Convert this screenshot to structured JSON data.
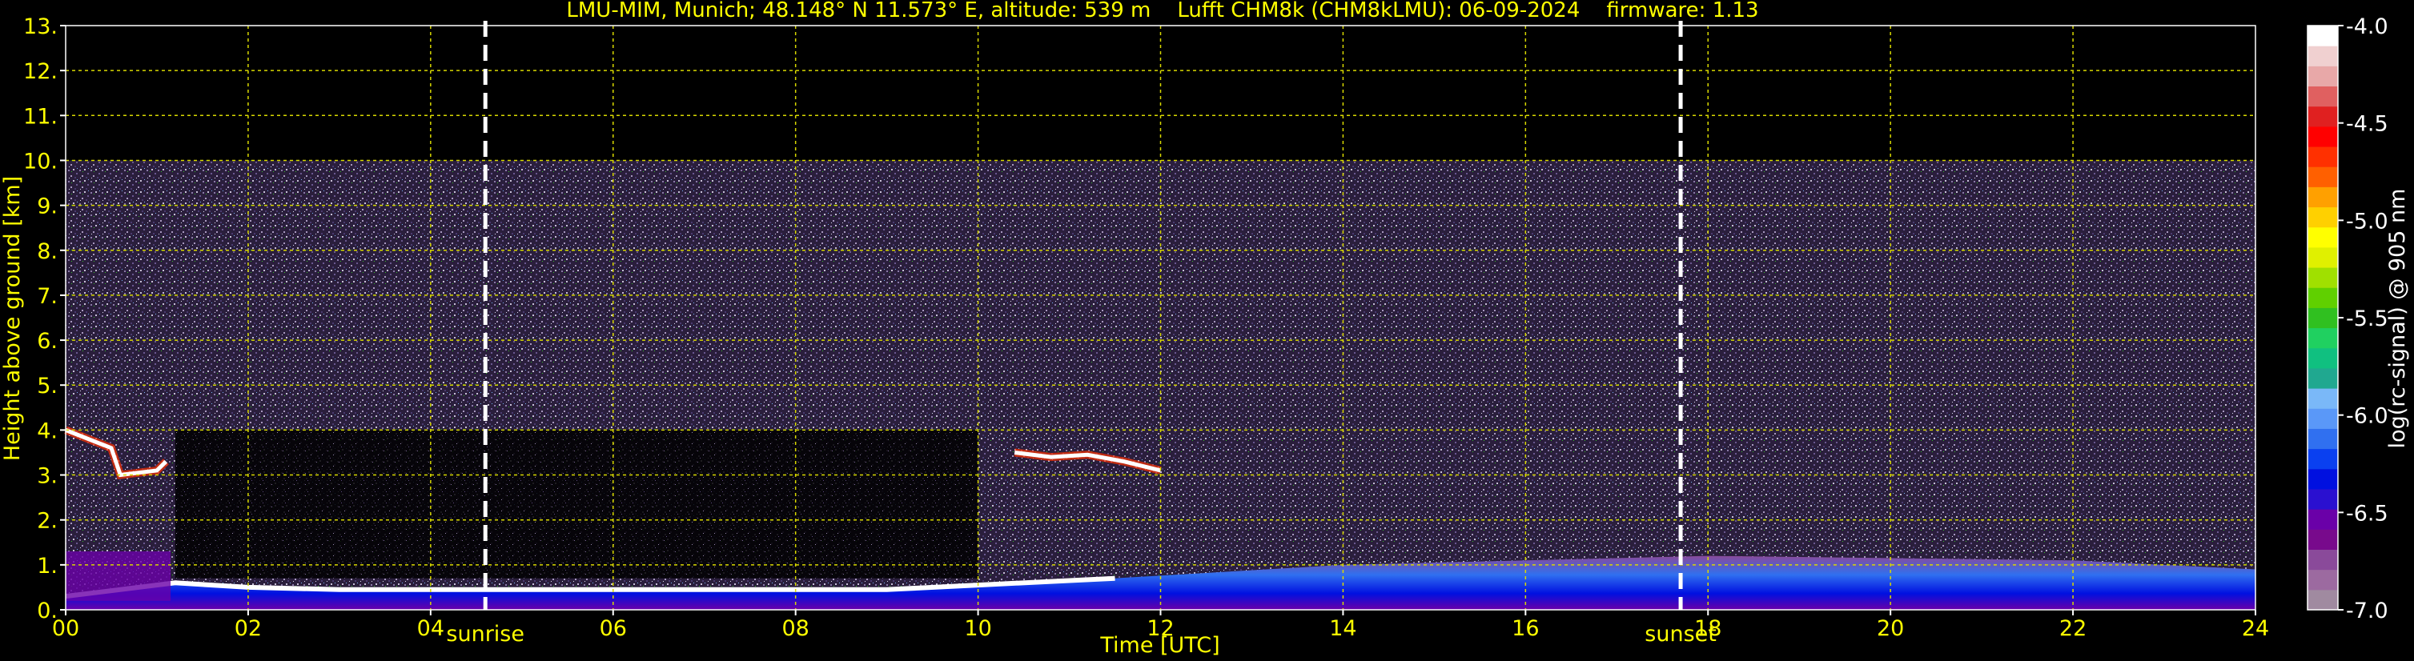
{
  "chart_data": {
    "type": "heatmap",
    "title": "LMU-MIM, Munich; 48.148° N 11.573° E, altitude: 539 m    Lufft CHM8k (CHM8kLMU): 06-09-2024    firmware: 1.13",
    "xlabel": "Time [UTC]",
    "ylabel": "Height above ground [km]",
    "xlim": [
      0,
      24
    ],
    "ylim": [
      0,
      13
    ],
    "xticks": [
      "00",
      "02",
      "04",
      "06",
      "08",
      "10",
      "12",
      "14",
      "16",
      "18",
      "20",
      "22",
      "24"
    ],
    "yticks": [
      "0.",
      "1.",
      "2.",
      "3.",
      "4.",
      "5.",
      "6.",
      "7.",
      "8.",
      "9.",
      "10.",
      "11.",
      "12.",
      "13."
    ],
    "grid": true,
    "signal_top_km": 10,
    "sunrise": {
      "label": "sunrise",
      "time": 4.6
    },
    "sunset": {
      "label": "sunset",
      "time": 17.7
    },
    "colorbar": {
      "label": "log(rc-signal) @ 905 nm",
      "range": [
        -7.0,
        -4.0
      ],
      "ticks": [
        "-4.0",
        "-4.5",
        "-5.0",
        "-5.5",
        "-6.0",
        "-6.5",
        "-7.0"
      ],
      "colors": [
        "#a08aa0",
        "#9c6aa0",
        "#8a4a9a",
        "#780a8c",
        "#6a00a8",
        "#2a10d0",
        "#0010e0",
        "#0a40f0",
        "#3070f0",
        "#5a98f8",
        "#7ab8f8",
        "#20a890",
        "#10c080",
        "#20d060",
        "#30c020",
        "#60d000",
        "#a0e000",
        "#e0f000",
        "#ffff00",
        "#ffd000",
        "#ffa000",
        "#ff6000",
        "#ff3000",
        "#ff0000",
        "#e02020",
        "#e06060",
        "#e8a8a8",
        "#f0d0d0",
        "#ffffff"
      ]
    },
    "features": [
      {
        "name": "boundary-layer-top",
        "time_h": [
          0.0,
          1.2,
          2.0,
          3.0,
          4.0,
          5.0,
          6.0,
          7.0,
          8.0,
          9.0,
          10.0,
          11.0,
          11.5
        ],
        "height_km": [
          0.3,
          0.6,
          0.5,
          0.45,
          0.45,
          0.45,
          0.45,
          0.45,
          0.45,
          0.45,
          0.55,
          0.65,
          0.7
        ]
      },
      {
        "name": "cloud-layer-morning",
        "time_h": [
          0.0,
          0.5,
          0.6,
          1.0,
          1.1
        ],
        "height_km": [
          4.0,
          3.6,
          3.0,
          3.1,
          3.3
        ]
      },
      {
        "name": "cloud-layer-midday",
        "time_h": [
          10.4,
          10.8,
          11.2,
          11.6,
          12.0
        ],
        "height_km": [
          3.5,
          3.4,
          3.45,
          3.3,
          3.1
        ]
      }
    ]
  }
}
